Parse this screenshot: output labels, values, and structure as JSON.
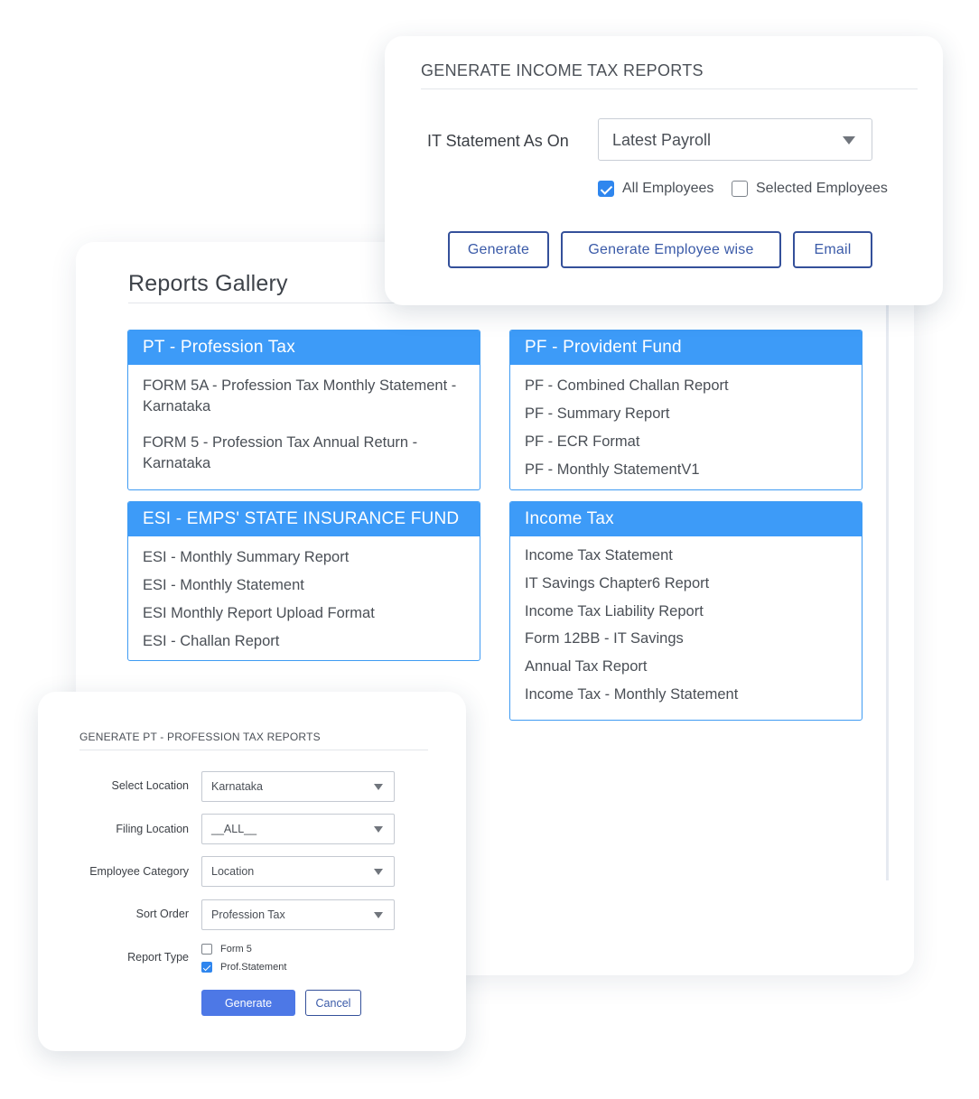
{
  "gallery": {
    "title": "Reports Gallery",
    "panels": [
      {
        "title": "PT - Profession Tax",
        "items": [
          "FORM 5A - Profession Tax Monthly Statement - Karnataka",
          "FORM 5 - Profession Tax Annual Return - Karnataka"
        ]
      },
      {
        "title": "PF - Provident Fund",
        "items": [
          "PF - Combined Challan Report",
          "PF - Summary Report",
          "PF - ECR Format",
          "PF - Monthly StatementV1"
        ]
      },
      {
        "title": "ESI - EMPS' STATE INSURANCE FUND",
        "items": [
          "ESI - Monthly Summary Report",
          "ESI - Monthly Statement",
          "ESI Monthly Report Upload Format",
          "ESI - Challan Report"
        ]
      },
      {
        "title": "Income Tax",
        "items": [
          "Income Tax Statement",
          "IT Savings Chapter6 Report",
          "Income Tax Liability Report",
          "Form 12BB - IT Savings",
          "Annual Tax Report",
          "Income Tax - Monthly Statement"
        ]
      }
    ]
  },
  "income_tax_modal": {
    "title": "GENERATE INCOME TAX REPORTS",
    "statement_label": "IT Statement As On",
    "statement_value": "Latest Payroll",
    "all_employees_label": "All Employees",
    "all_employees_checked": true,
    "selected_employees_label": "Selected Employees",
    "selected_employees_checked": false,
    "buttons": {
      "generate": "Generate",
      "generate_employee_wise": "Generate Employee wise",
      "email": "Email"
    }
  },
  "pt_modal": {
    "title": "GENERATE PT - PROFESSION TAX REPORTS",
    "fields": [
      {
        "label": "Select Location",
        "value": "Karnataka"
      },
      {
        "label": "Filing Location",
        "value": "__ALL__"
      },
      {
        "label": "Employee Category",
        "value": "Location"
      },
      {
        "label": "Sort Order",
        "value": "Profession Tax"
      }
    ],
    "report_type_label": "Report Type",
    "report_types": [
      {
        "label": "Form 5",
        "checked": false
      },
      {
        "label": "Prof.Statement",
        "checked": true
      }
    ],
    "generate_label": "Generate",
    "cancel_label": "Cancel"
  },
  "colors": {
    "panel_header": "#3d9bf8",
    "button_border": "#34509a",
    "primary_button": "#4d78e6",
    "checkbox_checked": "#2f86ee"
  }
}
